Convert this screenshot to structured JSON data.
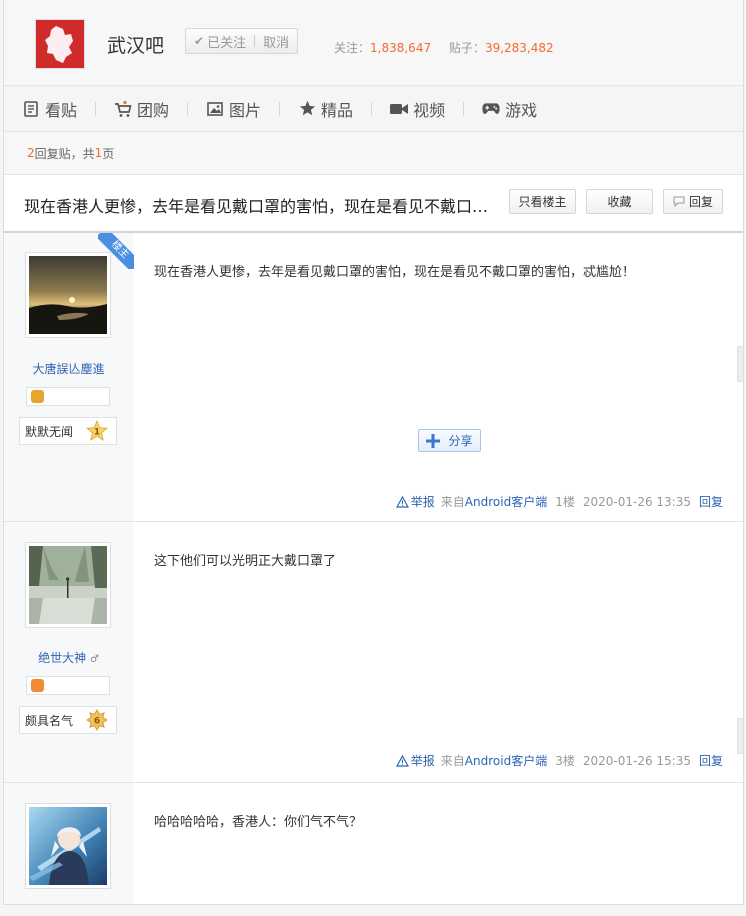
{
  "forum": {
    "name": "武汉吧",
    "follow_status": "已关注",
    "cancel_label": "取消",
    "followers_label": "关注：",
    "followers": "1,838,647",
    "posts_label": "贴子：",
    "posts": "39,283,482"
  },
  "nav": {
    "items": [
      {
        "label": "看贴",
        "icon": "document-icon"
      },
      {
        "label": "团购",
        "icon": "cart-icon"
      },
      {
        "label": "图片",
        "icon": "image-icon"
      },
      {
        "label": "精品",
        "icon": "star-icon"
      },
      {
        "label": "视频",
        "icon": "video-icon"
      },
      {
        "label": "游戏",
        "icon": "gamepad-icon"
      }
    ]
  },
  "pager": {
    "reply_count": "2",
    "reply_text": "回复贴，共",
    "pages": "1",
    "page_suffix": "页"
  },
  "thread": {
    "title": "现在香港人更惨，去年是看见戴口罩的害怕，现在是看见不戴口罩的害怕，忒尴尬！",
    "only_op_label": "只看楼主",
    "favorite_label": "收藏",
    "reply_label": "回复"
  },
  "posts": [
    {
      "username": "大唐誤亾塵進",
      "level_name": "默默无闻",
      "level": "1",
      "content": "现在香港人更惨，去年是看见戴口罩的害怕，现在是看见不戴口罩的害怕，忒尴尬！",
      "op_badge": "楼主",
      "share_label": "分享",
      "report_label": "举报",
      "source_prefix": "来自",
      "source": "Android客户端",
      "floor": "1楼",
      "time": "2020-01-26 13:35",
      "reply_label": "回复"
    },
    {
      "username": "绝世大神",
      "level_name": "颇具名气",
      "level": "6",
      "content": "这下他们可以光明正大戴口罩了",
      "report_label": "举报",
      "source_prefix": "来自",
      "source": "Android客户端",
      "floor": "3楼",
      "time": "2020-01-26 15:35",
      "reply_label": "回复"
    },
    {
      "content": "哈哈哈哈哈，香港人：你们气不气？"
    }
  ],
  "colors": {
    "accent_orange": "#f26b2e",
    "link_blue": "#2d64b3",
    "logo_red": "#d02b2b"
  }
}
